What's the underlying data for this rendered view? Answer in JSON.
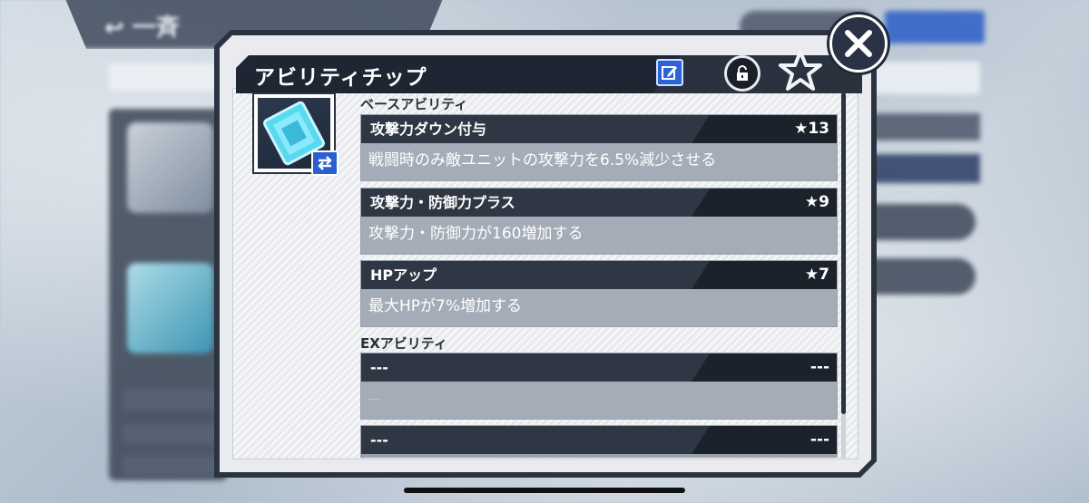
{
  "dialog": {
    "title": "アビリティチップ",
    "edit_icon": "edit-icon",
    "lock_icon": "unlock-icon",
    "star_icon": "favorite-star-icon",
    "close_icon": "close-icon"
  },
  "chip": {
    "icon": "ability-chip-icon",
    "swap_icon": "swap-icon"
  },
  "base_section": {
    "label": "ベースアビリティ",
    "abilities": [
      {
        "name": "攻撃力ダウン付与",
        "rank": "★13",
        "description": "戦闘時のみ敵ユニットの攻撃力を6.5%減少させる"
      },
      {
        "name": "攻撃力・防御力プラス",
        "rank": "★9",
        "description": "攻撃力・防御力が160増加する"
      },
      {
        "name": "HPアップ",
        "rank": "★7",
        "description": "最大HPが7%増加する"
      }
    ]
  },
  "ex_section": {
    "label": "EXアビリティ",
    "abilities": [
      {
        "name": "---",
        "rank": "---",
        "description": "---"
      },
      {
        "name": "---",
        "rank": "---",
        "description": ""
      }
    ]
  },
  "background": {
    "back_label": "↩ 一斉"
  },
  "colors": {
    "title_bar": "#1f2633",
    "accent_blue": "#2d63d6",
    "panel": "#e9ebee"
  }
}
